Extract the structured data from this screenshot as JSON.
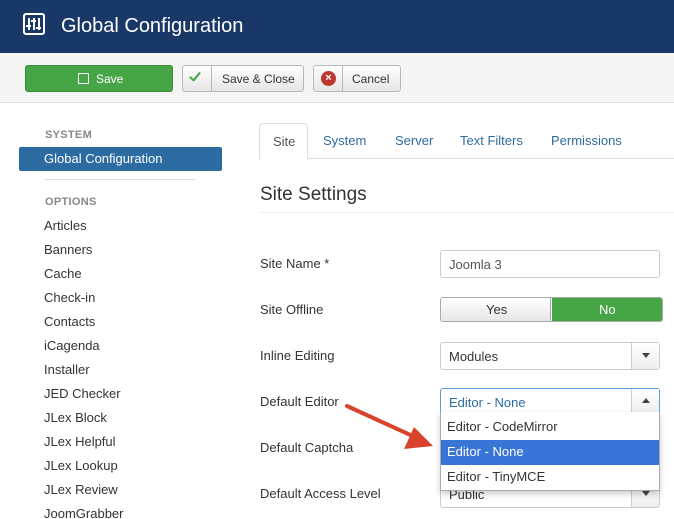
{
  "header": {
    "title": "Global Configuration",
    "icon": "sliders-icon"
  },
  "toolbar": {
    "save_label": "Save",
    "save_close_label": "Save & Close",
    "cancel_label": "Cancel"
  },
  "sidebar": {
    "system_heading": "SYSTEM",
    "active_item": "Global Configuration",
    "options_heading": "OPTIONS",
    "items": [
      "Articles",
      "Banners",
      "Cache",
      "Check-in",
      "Contacts",
      "iCagenda",
      "Installer",
      "JED Checker",
      "JLex Block",
      "JLex Helpful",
      "JLex Lookup",
      "JLex Review",
      "JoomGrabber"
    ]
  },
  "tabs": [
    "Site",
    "System",
    "Server",
    "Text Filters",
    "Permissions"
  ],
  "settings": {
    "title": "Site Settings",
    "site_name_label": "Site Name *",
    "site_name_value": "Joomla 3",
    "site_offline_label": "Site Offline",
    "offline_yes": "Yes",
    "offline_no": "No",
    "inline_editing_label": "Inline Editing",
    "inline_editing_value": "Modules",
    "default_editor_label": "Default Editor",
    "default_editor_value": "Editor - None",
    "editor_options": [
      "Editor - CodeMirror",
      "Editor - None",
      "Editor - TinyMCE"
    ],
    "default_captcha_label": "Default Captcha",
    "default_access_label": "Default Access Level",
    "default_access_value": "Public"
  },
  "colors": {
    "header_bg": "#1a3867",
    "accent": "#2d6ca2",
    "success": "#46a546",
    "highlight": "#3875d7",
    "arrow": "#d9432b"
  }
}
